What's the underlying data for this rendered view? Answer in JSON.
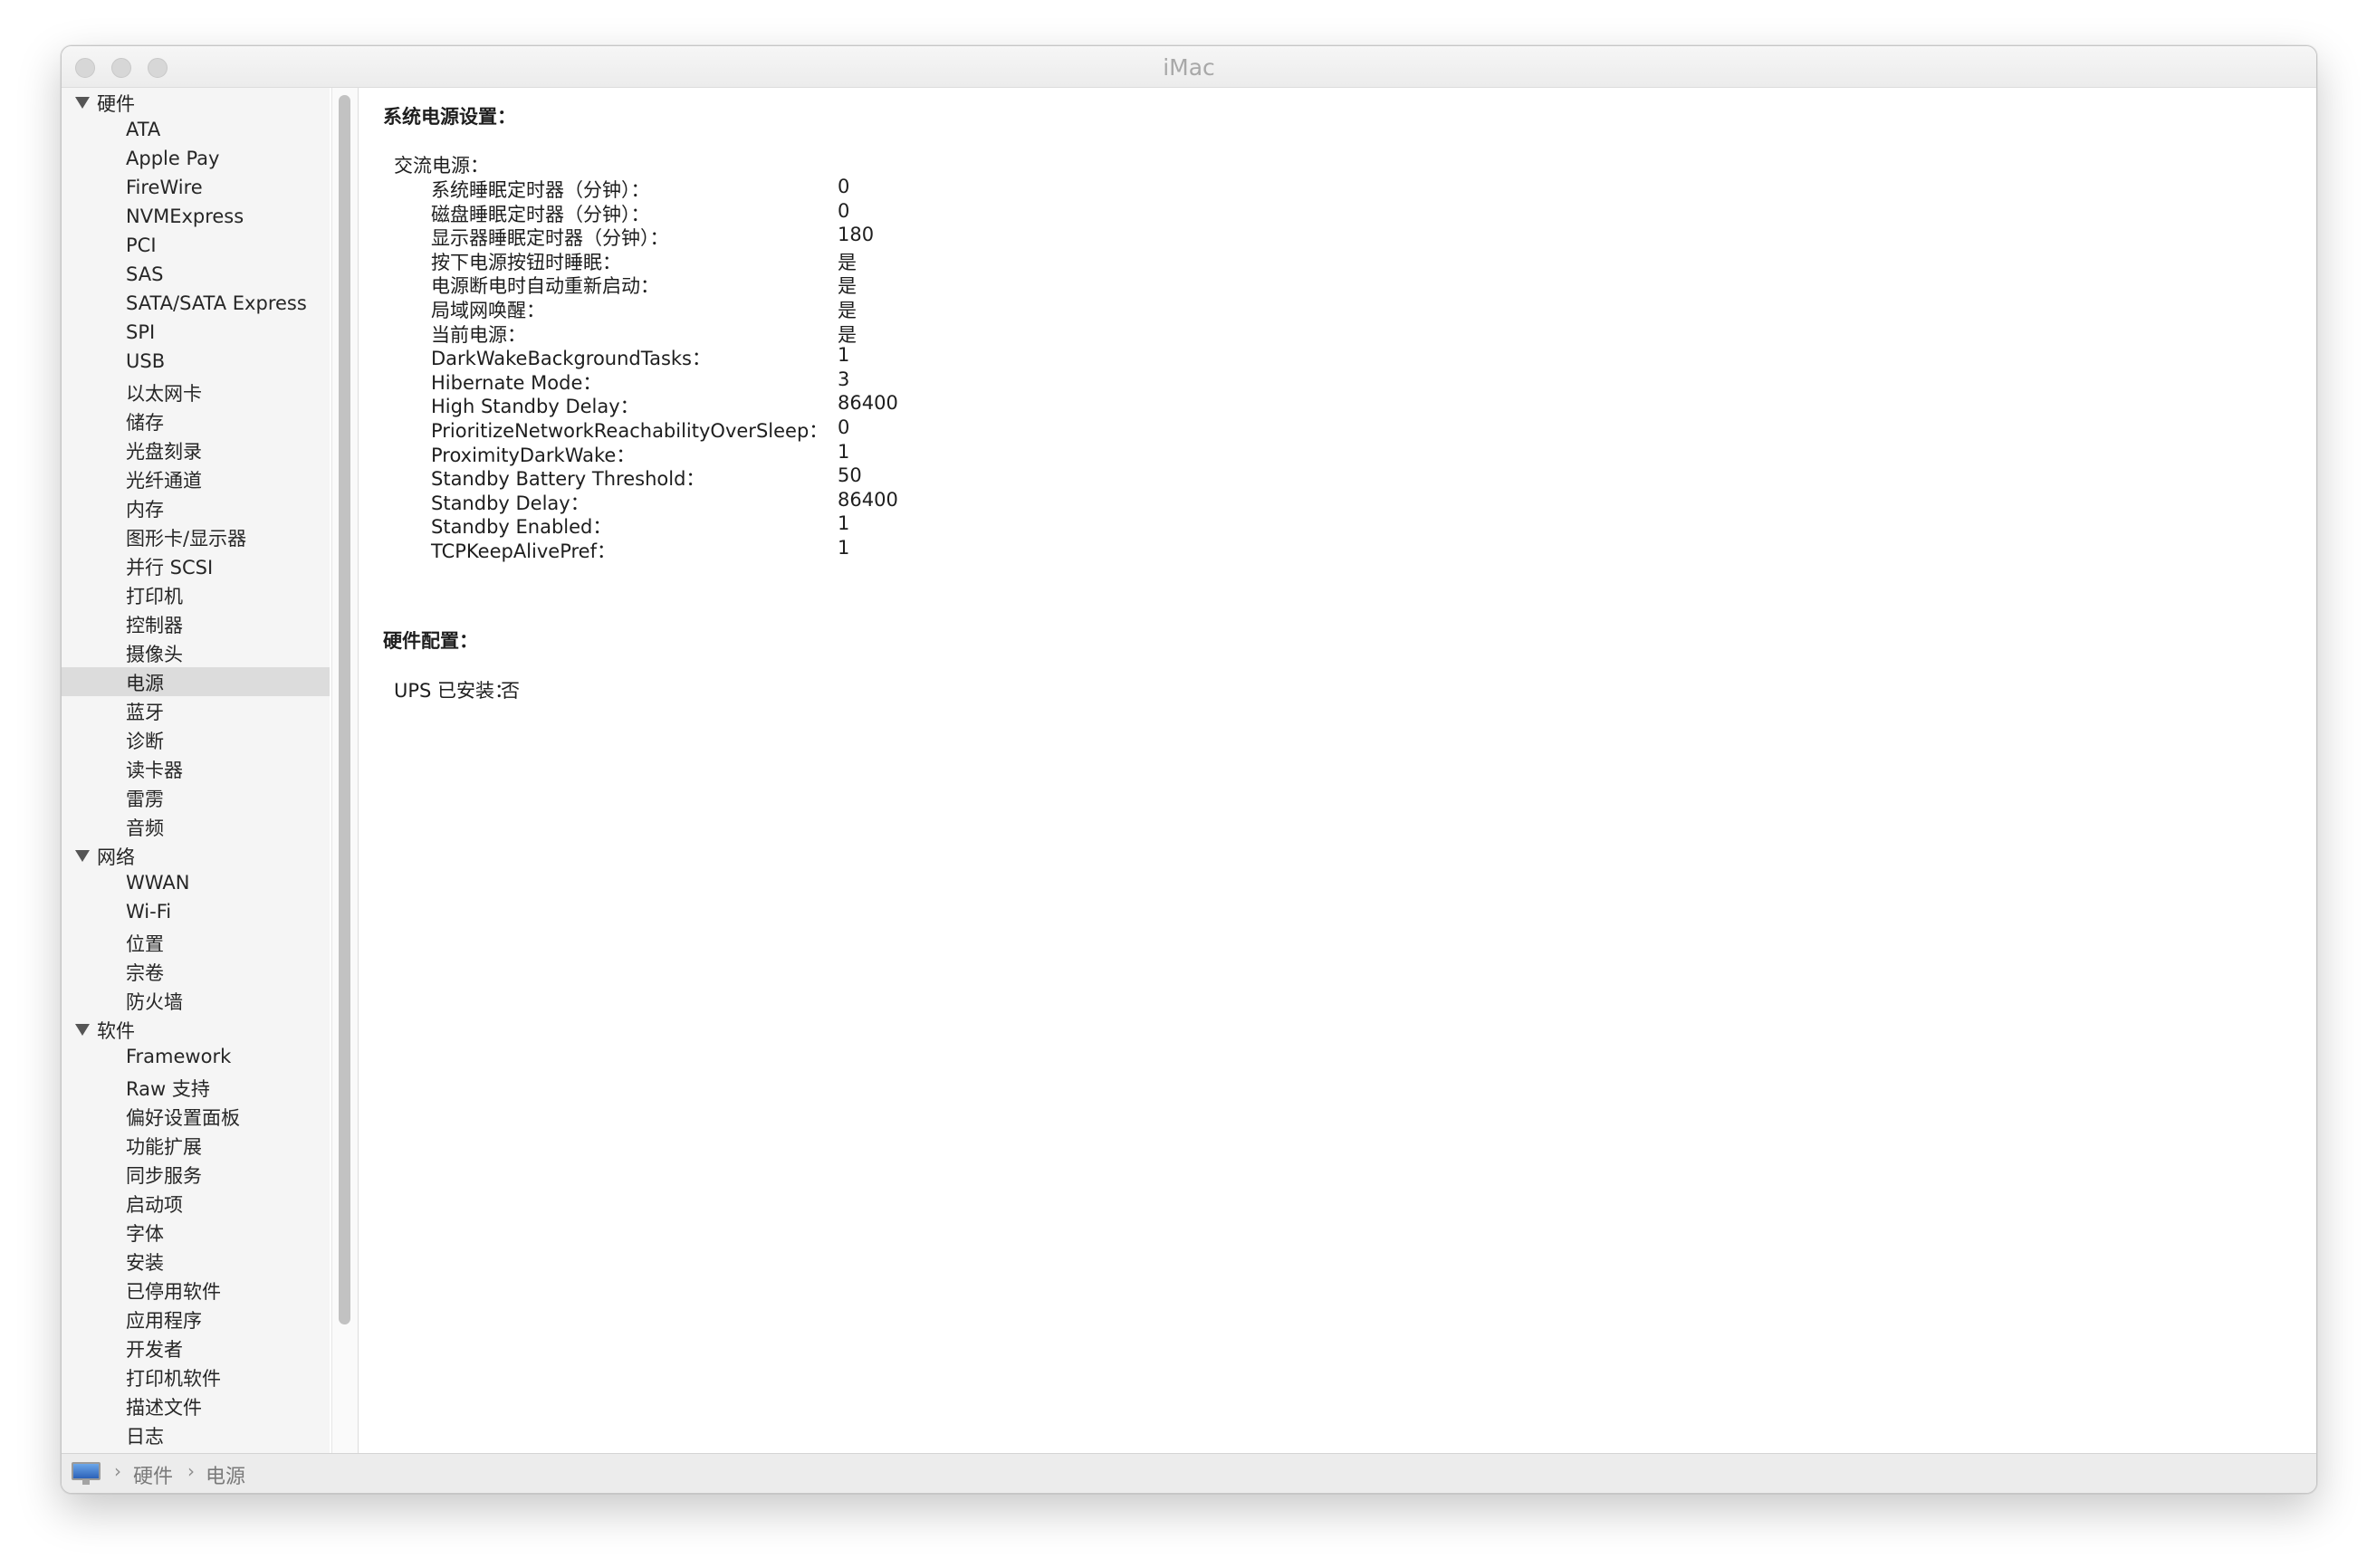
{
  "window": {
    "title": "iMac"
  },
  "sidebar": {
    "sections": [
      {
        "label": "硬件",
        "items": [
          "ATA",
          "Apple Pay",
          "FireWire",
          "NVMExpress",
          "PCI",
          "SAS",
          "SATA/SATA Express",
          "SPI",
          "USB",
          "以太网卡",
          "储存",
          "光盘刻录",
          "光纤通道",
          "内存",
          "图形卡/显示器",
          "并行 SCSI",
          "打印机",
          "控制器",
          "摄像头",
          "电源",
          "蓝牙",
          "诊断",
          "读卡器",
          "雷雳",
          "音频"
        ]
      },
      {
        "label": "网络",
        "items": [
          "WWAN",
          "Wi-Fi",
          "位置",
          "宗卷",
          "防火墙"
        ]
      },
      {
        "label": "软件",
        "items": [
          "Framework",
          "Raw 支持",
          "偏好设置面板",
          "功能扩展",
          "同步服务",
          "启动项",
          "字体",
          "安装",
          "已停用软件",
          "应用程序",
          "开发者",
          "打印机软件",
          "描述文件",
          "日志"
        ]
      }
    ],
    "selected": "电源"
  },
  "content": {
    "section1_title": "系统电源设置：",
    "ac_power_label": "交流电源：",
    "settings": [
      {
        "key": "系统睡眠定时器（分钟）：",
        "value": "0"
      },
      {
        "key": "磁盘睡眠定时器（分钟）：",
        "value": "0"
      },
      {
        "key": "显示器睡眠定时器（分钟）：",
        "value": "180"
      },
      {
        "key": "按下电源按钮时睡眠：",
        "value": "是"
      },
      {
        "key": "电源断电时自动重新启动：",
        "value": "是"
      },
      {
        "key": "局域网唤醒：",
        "value": "是"
      },
      {
        "key": "当前电源：",
        "value": "是"
      },
      {
        "key": "DarkWakeBackgroundTasks：",
        "value": "1"
      },
      {
        "key": "Hibernate Mode：",
        "value": "3"
      },
      {
        "key": "High Standby Delay：",
        "value": "86400"
      },
      {
        "key": "PrioritizeNetworkReachabilityOverSleep：",
        "value": "0"
      },
      {
        "key": "ProximityDarkWake：",
        "value": "1"
      },
      {
        "key": "Standby Battery Threshold：",
        "value": "50"
      },
      {
        "key": "Standby Delay：",
        "value": "86400"
      },
      {
        "key": "Standby Enabled：",
        "value": "1"
      },
      {
        "key": "TCPKeepAlivePref：",
        "value": "1"
      }
    ],
    "section2_title": "硬件配置：",
    "ups_label": "UPS 已安装：",
    "ups_value": "否"
  },
  "pathbar": {
    "icon": "imac-icon",
    "crumbs": [
      "硬件",
      "电源"
    ]
  }
}
